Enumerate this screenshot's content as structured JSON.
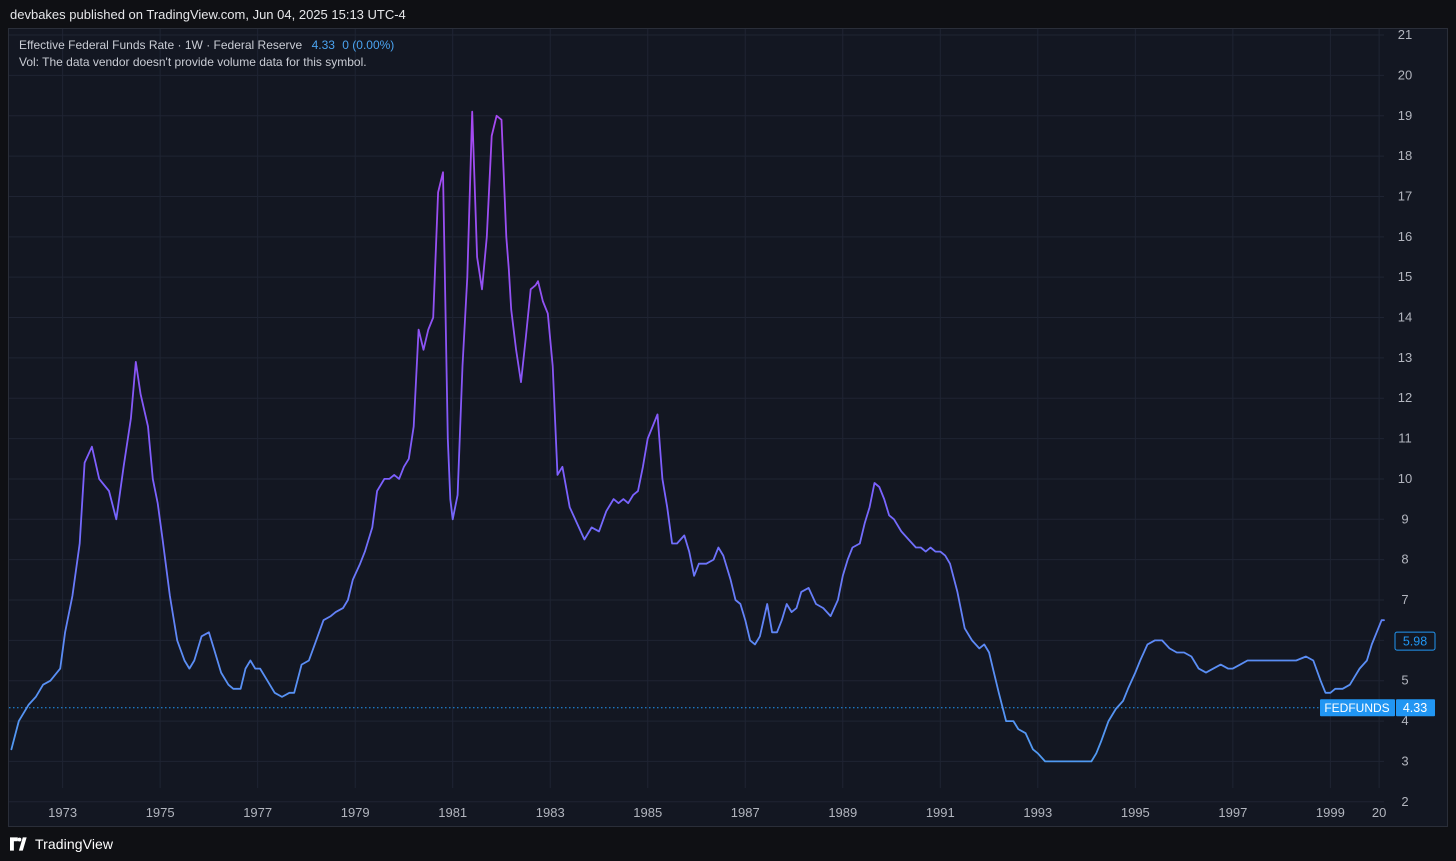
{
  "header": {
    "publisher_line": "devbakes published on TradingView.com, Jun 04, 2025 15:13 UTC-4"
  },
  "legend": {
    "title": "Effective Federal Funds Rate · 1W · Federal Reserve",
    "value": "4.33",
    "change": "0 (0.00%)",
    "volume_note": "Vol: The data vendor doesn't provide volume data for this symbol."
  },
  "footer": {
    "brand": "TradingView"
  },
  "colors": {
    "background": "#131722",
    "grid": "#1f2433",
    "axis_text": "#b2b5be",
    "line_low": "#4aa3f0",
    "line_mid": "#7b61ff",
    "line_high": "#b045ef",
    "price_tag": "#2196f3"
  },
  "chart_data": {
    "type": "line",
    "title": "Effective Federal Funds Rate · 1W · Federal Reserve",
    "xlabel": "",
    "ylabel": "",
    "ylim": [
      1.35,
      21.15
    ],
    "xlim": [
      1971.9,
      2000.1
    ],
    "y_ticks": [
      "2",
      "3",
      "4",
      "5",
      "6",
      "7",
      "8",
      "9",
      "10",
      "11",
      "12",
      "13",
      "14",
      "15",
      "16",
      "17",
      "18",
      "19",
      "20",
      "21"
    ],
    "x_ticks": [
      "1973",
      "1975",
      "1977",
      "1979",
      "1981",
      "1983",
      "1985",
      "1987",
      "1989",
      "1991",
      "1993",
      "1995",
      "1997",
      "1999",
      "20"
    ],
    "grid": true,
    "price_labels": [
      {
        "label": "",
        "value": "5.98",
        "y": 5.98,
        "style": "outline"
      },
      {
        "label": "FEDFUNDS",
        "value": "4.33",
        "y": 4.33,
        "style": "filled"
      }
    ],
    "x": [
      1971.95,
      1972.1,
      1972.3,
      1972.45,
      1972.6,
      1972.75,
      1972.95,
      1973.05,
      1973.2,
      1973.35,
      1973.45,
      1973.6,
      1973.75,
      1973.95,
      1974.1,
      1974.25,
      1974.4,
      1974.5,
      1974.6,
      1974.75,
      1974.85,
      1974.95,
      1975.05,
      1975.2,
      1975.35,
      1975.5,
      1975.6,
      1975.7,
      1975.85,
      1976.0,
      1976.1,
      1976.25,
      1976.4,
      1976.5,
      1976.65,
      1976.75,
      1976.85,
      1976.95,
      1977.05,
      1977.2,
      1977.35,
      1977.5,
      1977.65,
      1977.75,
      1977.9,
      1978.05,
      1978.2,
      1978.35,
      1978.5,
      1978.6,
      1978.75,
      1978.85,
      1978.95,
      1979.1,
      1979.2,
      1979.35,
      1979.45,
      1979.6,
      1979.7,
      1979.8,
      1979.9,
      1980.0,
      1980.1,
      1980.2,
      1980.3,
      1980.4,
      1980.5,
      1980.6,
      1980.7,
      1980.8,
      1980.9,
      1980.95,
      1981.0,
      1981.1,
      1981.2,
      1981.3,
      1981.4,
      1981.5,
      1981.6,
      1981.7,
      1981.8,
      1981.9,
      1982.0,
      1982.1,
      1982.15,
      1982.2,
      1982.3,
      1982.4,
      1982.5,
      1982.6,
      1982.7,
      1982.75,
      1982.85,
      1982.95,
      1983.05,
      1983.15,
      1983.25,
      1983.4,
      1983.55,
      1983.7,
      1983.85,
      1984.0,
      1984.15,
      1984.3,
      1984.4,
      1984.5,
      1984.6,
      1984.7,
      1984.8,
      1984.9,
      1985.0,
      1985.1,
      1985.2,
      1985.3,
      1985.4,
      1985.5,
      1985.6,
      1985.75,
      1985.85,
      1985.95,
      1986.05,
      1986.2,
      1986.35,
      1986.45,
      1986.55,
      1986.7,
      1986.8,
      1986.9,
      1987.0,
      1987.1,
      1987.2,
      1987.3,
      1987.45,
      1987.55,
      1987.65,
      1987.75,
      1987.85,
      1987.95,
      1988.05,
      1988.15,
      1988.3,
      1988.45,
      1988.6,
      1988.75,
      1988.9,
      1989.0,
      1989.1,
      1989.2,
      1989.35,
      1989.45,
      1989.55,
      1989.65,
      1989.75,
      1989.85,
      1989.95,
      1990.05,
      1990.2,
      1990.35,
      1990.5,
      1990.6,
      1990.7,
      1990.8,
      1990.9,
      1991.0,
      1991.1,
      1991.2,
      1991.35,
      1991.5,
      1991.65,
      1991.8,
      1991.9,
      1992.0,
      1992.1,
      1992.2,
      1992.35,
      1992.5,
      1992.6,
      1992.75,
      1992.9,
      1993.0,
      1993.15,
      1993.3,
      1993.5,
      1993.65,
      1993.8,
      1993.9,
      1994.0,
      1994.1,
      1994.2,
      1994.3,
      1994.45,
      1994.6,
      1994.75,
      1994.85,
      1995.0,
      1995.1,
      1995.25,
      1995.4,
      1995.55,
      1995.7,
      1995.85,
      1996.0,
      1996.15,
      1996.3,
      1996.45,
      1996.6,
      1996.75,
      1996.9,
      1997.0,
      1997.15,
      1997.3,
      1997.5,
      1997.7,
      1997.9,
      1998.1,
      1998.3,
      1998.5,
      1998.65,
      1998.8,
      1998.9,
      1999.0,
      1999.1,
      1999.25,
      1999.4,
      1999.5,
      1999.6,
      1999.75,
      1999.85,
      1999.95,
      2000.05,
      2000.1
    ],
    "series": [
      {
        "values": [
          3.3,
          4.0,
          4.4,
          4.6,
          4.9,
          5.0,
          5.3,
          6.2,
          7.1,
          8.4,
          10.4,
          10.8,
          10.0,
          9.7,
          9.0,
          10.3,
          11.5,
          12.9,
          12.1,
          11.3,
          10.0,
          9.4,
          8.5,
          7.1,
          6.0,
          5.5,
          5.3,
          5.5,
          6.1,
          6.2,
          5.8,
          5.2,
          4.9,
          4.8,
          4.8,
          5.3,
          5.5,
          5.3,
          5.3,
          5.0,
          4.7,
          4.6,
          4.7,
          4.7,
          5.4,
          5.5,
          6.0,
          6.5,
          6.6,
          6.7,
          6.8,
          7.0,
          7.5,
          7.9,
          8.2,
          8.8,
          9.7,
          10.0,
          10.0,
          10.1,
          10.0,
          10.3,
          10.5,
          11.3,
          13.7,
          13.2,
          13.7,
          14.0,
          17.1,
          17.6,
          11.0,
          9.5,
          9.0,
          9.6,
          12.8,
          15.0,
          19.1,
          15.5,
          14.7,
          16.0,
          18.5,
          19.0,
          18.9,
          16.0,
          15.2,
          14.2,
          13.2,
          12.4,
          13.5,
          14.7,
          14.8,
          14.9,
          14.4,
          14.1,
          12.8,
          10.1,
          10.3,
          9.3,
          8.9,
          8.5,
          8.8,
          8.7,
          9.2,
          9.5,
          9.4,
          9.5,
          9.4,
          9.6,
          9.7,
          10.3,
          11.0,
          11.3,
          11.6,
          10.0,
          9.3,
          8.4,
          8.4,
          8.6,
          8.2,
          7.6,
          7.9,
          7.9,
          8.0,
          8.3,
          8.1,
          7.5,
          7.0,
          6.9,
          6.5,
          6.0,
          5.9,
          6.1,
          6.9,
          6.2,
          6.2,
          6.5,
          6.9,
          6.7,
          6.8,
          7.2,
          7.3,
          6.9,
          6.8,
          6.6,
          7.0,
          7.6,
          8.0,
          8.3,
          8.4,
          8.9,
          9.3,
          9.9,
          9.8,
          9.5,
          9.1,
          9.0,
          8.7,
          8.5,
          8.3,
          8.3,
          8.2,
          8.3,
          8.2,
          8.2,
          8.1,
          7.9,
          7.2,
          6.3,
          6.0,
          5.8,
          5.9,
          5.7,
          5.2,
          4.7,
          4.0,
          4.0,
          3.8,
          3.7,
          3.3,
          3.2,
          3.0,
          3.0,
          3.0,
          3.0,
          3.0,
          3.0,
          3.0,
          3.0,
          3.2,
          3.5,
          4.0,
          4.3,
          4.5,
          4.8,
          5.2,
          5.5,
          5.9,
          6.0,
          6.0,
          5.8,
          5.7,
          5.7,
          5.6,
          5.3,
          5.2,
          5.3,
          5.4,
          5.3,
          5.3,
          5.4,
          5.5,
          5.5,
          5.5,
          5.5,
          5.5,
          5.5,
          5.6,
          5.5,
          5.0,
          4.7,
          4.7,
          4.8,
          4.8,
          4.9,
          5.1,
          5.3,
          5.5,
          5.9,
          6.2,
          6.5,
          6.5,
          6.4,
          6.0
        ]
      }
    ]
  }
}
